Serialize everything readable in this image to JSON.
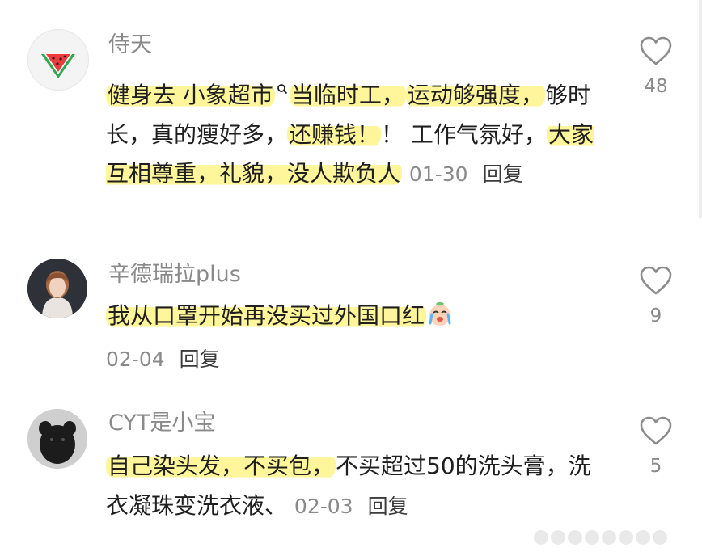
{
  "comments": [
    {
      "avatar": "watermelon-avatar",
      "username": "侍天",
      "segments": [
        {
          "t": "健身去 小象超市",
          "hl": true
        },
        {
          "t": "当临时工，",
          "hl": true
        },
        {
          "t": "运动够强度，",
          "hl": true
        },
        {
          "t": "够时长，真的瘦好多，",
          "hl": false
        },
        {
          "t": "还赚钱！",
          "hl": true
        },
        {
          "t": "！ 工作气氛好，",
          "hl": false
        },
        {
          "t": "大家互相尊重，礼貌，没人欺负人",
          "hl": true
        }
      ],
      "date": "01-30",
      "reply": "回复",
      "likes": "48"
    },
    {
      "avatar": "woman-portrait-avatar",
      "username": "辛德瑞拉plus",
      "segments": [
        {
          "t": "我从口罩开始再没买过外国口红",
          "hl": true
        }
      ],
      "emoji": "crying-face-emoji",
      "date": "02-04",
      "reply": "回复",
      "likes": "9"
    },
    {
      "avatar": "black-puppy-avatar",
      "username": "CYT是小宝",
      "segments": [
        {
          "t": "自己染头发，不买包，",
          "hl": true
        },
        {
          "t": "不买超过50的洗头膏，洗衣凝珠变洗衣液、",
          "hl": false
        }
      ],
      "date": "02-03",
      "reply": "回复",
      "likes": "5"
    }
  ],
  "colors": {
    "highlight": "#fff59a",
    "meta": "#8a8a8a",
    "text": "#1f1f1f"
  }
}
